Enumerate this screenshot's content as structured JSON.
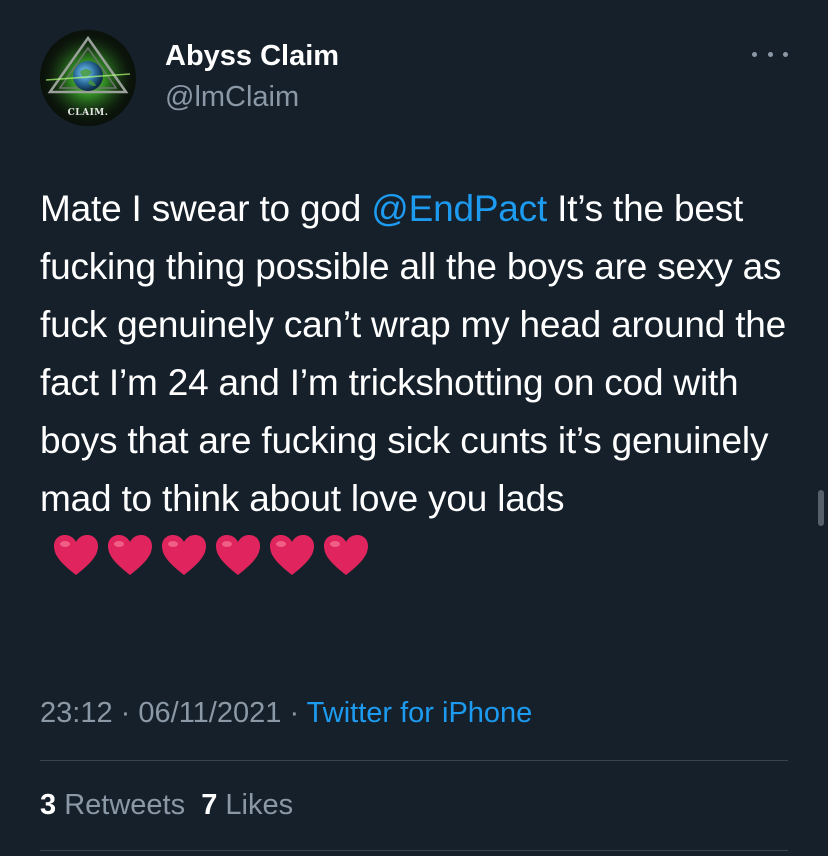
{
  "author": {
    "display_name": "Abyss Claim",
    "handle": "@lmClaim",
    "avatar_label": "CLAIM."
  },
  "tweet": {
    "text_parts": {
      "before_mention": "Mate I swear to god ",
      "mention": "@EndPact",
      "after_mention": " It’s the best fucking thing possible all the boys are sexy as fuck genuinely can’t wrap my head around the fact I’m 24 and I’m trickshotting on cod with boys that are fucking sick cunts it’s genuinely mad to think about love you lads"
    },
    "hearts": [
      "❤️",
      "❤️",
      "❤️",
      "❤️",
      "❤️",
      "❤️"
    ]
  },
  "meta": {
    "time": "23:12",
    "separator": "·",
    "date": "06/11/2021",
    "source": "Twitter for iPhone"
  },
  "stats": {
    "retweets_count": "3",
    "retweets_label": "Retweets",
    "likes_count": "7",
    "likes_label": "Likes"
  },
  "colors": {
    "background": "#15202b",
    "text_primary": "#ffffff",
    "text_secondary": "#8b98a5",
    "accent": "#1d9bf0",
    "divider": "#38444d",
    "heart": "#e0245e"
  },
  "icons": {
    "more": "more-horizontal-icon",
    "heart": "heart-emoji-icon"
  }
}
